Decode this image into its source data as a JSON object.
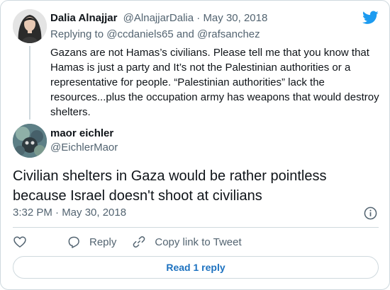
{
  "parent_tweet": {
    "author_name": "Dalia Alnajjar",
    "author_handle": "@AlnajjarDalia",
    "separator": " · ",
    "date": "May 30, 2018",
    "replying_prefix": "Replying to ",
    "replying_to_1": "@ccdaniels65",
    "replying_and": " and ",
    "replying_to_2": "@rafsanchez",
    "text": "Gazans are not Hamas’s civilians. Please tell me that you know that Hamas is just a party and It’s not the Palestinian authorities or a representative for people. “Palestinian authorities” lack the resources...plus the occupation army has weapons that would destroy shelters."
  },
  "main_tweet": {
    "author_name": "maor eichler",
    "author_handle": "@EichlerMaor",
    "text": "Civilian shelters in Gaza would be rather pointless because Israel doesn't shoot at civilians",
    "timestamp": "3:32 PM · May 30, 2018"
  },
  "actions": {
    "reply_label": "Reply",
    "copy_link_label": "Copy link to Tweet"
  },
  "read_reply_label": "Read 1 reply",
  "colors": {
    "twitter_blue": "#1d9bf0",
    "text_primary": "#0f1419",
    "text_secondary": "#536471",
    "border": "#cfd9de",
    "link": "#1d72c0"
  },
  "icons": [
    "twitter-bird-icon",
    "info-icon",
    "heart-icon",
    "reply-icon",
    "link-icon"
  ]
}
